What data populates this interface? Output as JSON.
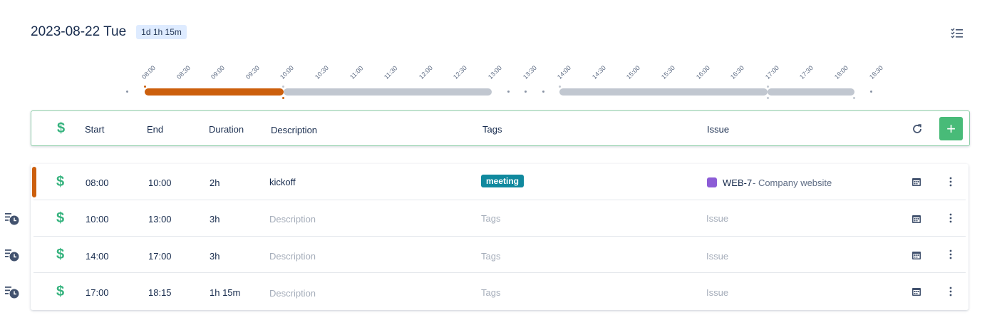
{
  "header": {
    "date": "2023-08-22 Tue",
    "total": "1d 1h 15m"
  },
  "timeline": {
    "ticks": [
      "08:00",
      "08:30",
      "09:00",
      "09:30",
      "10:00",
      "10:30",
      "11:00",
      "11:30",
      "12:00",
      "12:30",
      "13:00",
      "13:30",
      "14:00",
      "14:30",
      "15:00",
      "15:30",
      "16:00",
      "16:30",
      "17:00",
      "17:30",
      "18:00",
      "18:30"
    ],
    "colors": {
      "active": "#cc5f0d",
      "idle": "#c1c7d0"
    }
  },
  "columns": {
    "start": "Start",
    "end": "End",
    "duration": "Duration",
    "description": "Description",
    "tags": "Tags",
    "issue": "Issue"
  },
  "entries": [
    {
      "start": "08:00",
      "end": "10:00",
      "duration": "2h",
      "description": "kickoff",
      "tag": "meeting",
      "issue_key": "WEB-7",
      "issue_title": "- Company website"
    },
    {
      "start": "10:00",
      "end": "13:00",
      "duration": "3h",
      "description_placeholder": "Description",
      "tags_placeholder": "Tags",
      "issue_placeholder": "Issue"
    },
    {
      "start": "14:00",
      "end": "17:00",
      "duration": "3h",
      "description_placeholder": "Description",
      "tags_placeholder": "Tags",
      "issue_placeholder": "Issue"
    },
    {
      "start": "17:00",
      "end": "18:15",
      "duration": "1h 15m",
      "description_placeholder": "Description",
      "tags_placeholder": "Tags",
      "issue_placeholder": "Issue"
    }
  ],
  "icons": {
    "billable": "dollar-icon",
    "refresh": "refresh-icon",
    "add": "plus-icon",
    "calendar": "calendar-icon",
    "more": "kebab-icon",
    "list": "checklist-icon",
    "history": "list-clock-icon"
  },
  "colors": {
    "accent": "#48bb78",
    "billable": "#36b37e",
    "running": "#cc5f0d",
    "tag": "#10899e",
    "issue": "#8c5cd6"
  },
  "symbols": {
    "dollar": "$",
    "plus": "+"
  }
}
